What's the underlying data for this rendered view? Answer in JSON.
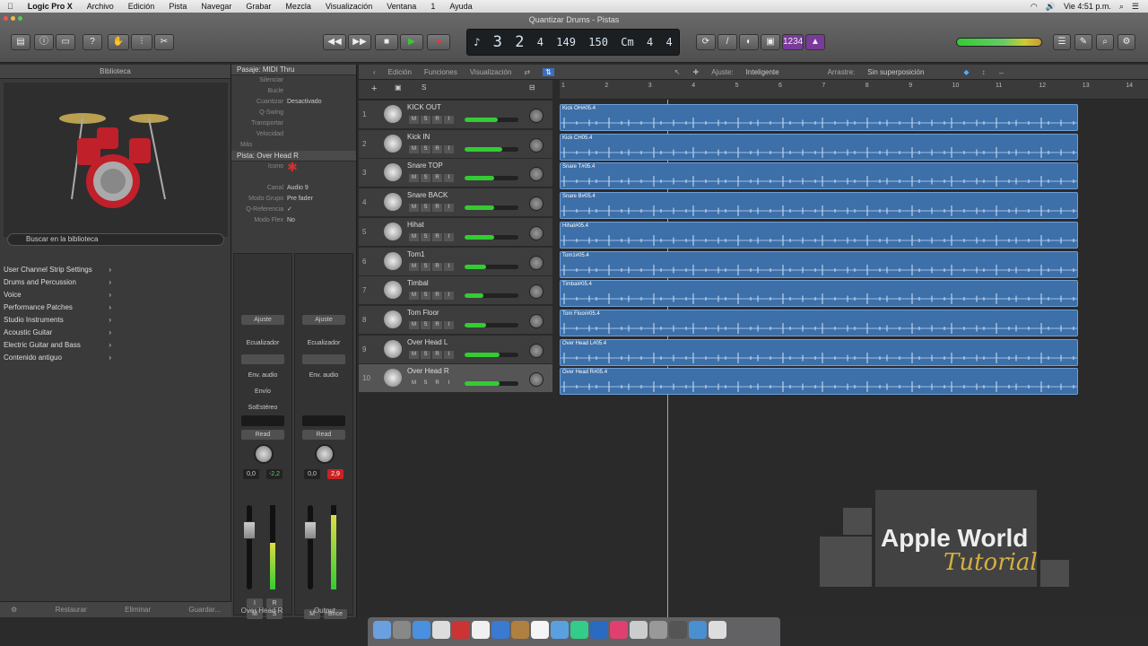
{
  "menubar": {
    "app": "Logic Pro X",
    "items": [
      "Archivo",
      "Edición",
      "Pista",
      "Navegar",
      "Grabar",
      "Mezcla",
      "Visualización",
      "Ventana",
      "1",
      "Ayuda"
    ],
    "clock": "Vie 4:51 p.m."
  },
  "window": {
    "title": "Quantizar Drums - Pistas"
  },
  "lcd": {
    "bar": "3",
    "beat": "2",
    "div": "4",
    "tick": "149",
    "tempo": "150",
    "key": "Cm",
    "sig_top": "4",
    "sig_bottom": "4"
  },
  "toolbar": {
    "count_in": "1234"
  },
  "library": {
    "title": "Biblioteca",
    "search_placeholder": "Buscar en la biblioteca",
    "items": [
      "User Channel Strip Settings",
      "Drums and Percussion",
      "Voice",
      "Performance Patches",
      "Studio Instruments",
      "Acoustic Guitar",
      "Electric Guitar and Bass",
      "Contenido antiguo"
    ],
    "footer_left": "Restaurar",
    "footer_mid": "Eliminar",
    "footer_right": "Guardar..."
  },
  "inspector": {
    "region_header": "Pasaje: MIDI Thru",
    "region_rows": [
      {
        "k": "Silenciar",
        "v": ""
      },
      {
        "k": "Bucle",
        "v": ""
      },
      {
        "k": "Cuantizar",
        "v": "Desactivado"
      },
      {
        "k": "Q-Swing",
        "v": ""
      },
      {
        "k": "Transportar",
        "v": ""
      },
      {
        "k": "Velocidad",
        "v": ""
      }
    ],
    "more": "Más",
    "track_header": "Pista: Over Head R",
    "track_rows": [
      {
        "k": "Icono",
        "v": ""
      },
      {
        "k": "Canal",
        "v": "Audio 9"
      },
      {
        "k": "Modo Grupo",
        "v": "Pre fader"
      },
      {
        "k": "Q-Referencia",
        "v": "✓"
      },
      {
        "k": "Modo Flex",
        "v": "No"
      }
    ],
    "strip1": {
      "setting": "Ajuste",
      "eq": "Ecualizador",
      "link": "Env. audio",
      "sends": "Envío",
      "input": "SoEstéreo",
      "auto": "Read",
      "v1": "0,0",
      "v2": "-2,2",
      "bottom_l": "M",
      "bottom_r": "S",
      "bnc_l": "I",
      "bnc_r": "R",
      "name": "Over Head R"
    },
    "strip2": {
      "setting": "Ajuste",
      "eq": "Ecualizador",
      "link": "Env. audio",
      "sends": "",
      "input": "",
      "auto": "Read",
      "v1": "0,0",
      "v2": "2,9",
      "bottom_l": "M",
      "bnc_l": "Bnce",
      "name": "Output"
    }
  },
  "edit": {
    "menus": [
      "Edición",
      "Funciones",
      "Visualización"
    ],
    "snap_label": "Ajuste:",
    "snap": "Inteligente",
    "drag_label": "Arrastre:",
    "drag": "Sin superposición"
  },
  "ruler": [
    "1",
    "2",
    "3",
    "4",
    "5",
    "6",
    "7",
    "8",
    "9",
    "10",
    "11",
    "12",
    "13",
    "14"
  ],
  "tracks": [
    {
      "num": "1",
      "name": "KICK OUT",
      "region": "Kick OH#05.4",
      "vol": 0.62
    },
    {
      "num": "2",
      "name": "Kick IN",
      "region": "Kick CH05.4",
      "vol": 0.7
    },
    {
      "num": "3",
      "name": "Snare TOP",
      "region": "Snare T#05.4",
      "vol": 0.55
    },
    {
      "num": "4",
      "name": "Snare BACK",
      "region": "Snare B#05.4",
      "vol": 0.55
    },
    {
      "num": "5",
      "name": "Hihat",
      "region": "Hihat#05.4",
      "vol": 0.55
    },
    {
      "num": "6",
      "name": "Tom1",
      "region": "Tom1#05.4",
      "vol": 0.4
    },
    {
      "num": "7",
      "name": "Timbal",
      "region": "Timbal#05.4",
      "vol": 0.35
    },
    {
      "num": "8",
      "name": "Tom Floor",
      "region": "Tom Floor#05.4",
      "vol": 0.4
    },
    {
      "num": "9",
      "name": "Over Head L",
      "region": "Over Head L#05.4",
      "vol": 0.65
    },
    {
      "num": "10",
      "name": "Over Head R",
      "region": "Over Head R#05.4",
      "vol": 0.65
    }
  ],
  "watermark": {
    "line1": "Apple World",
    "line2": "Tutorial"
  },
  "colors": {
    "region": "#3d6fa8",
    "accent": "#3c3"
  }
}
